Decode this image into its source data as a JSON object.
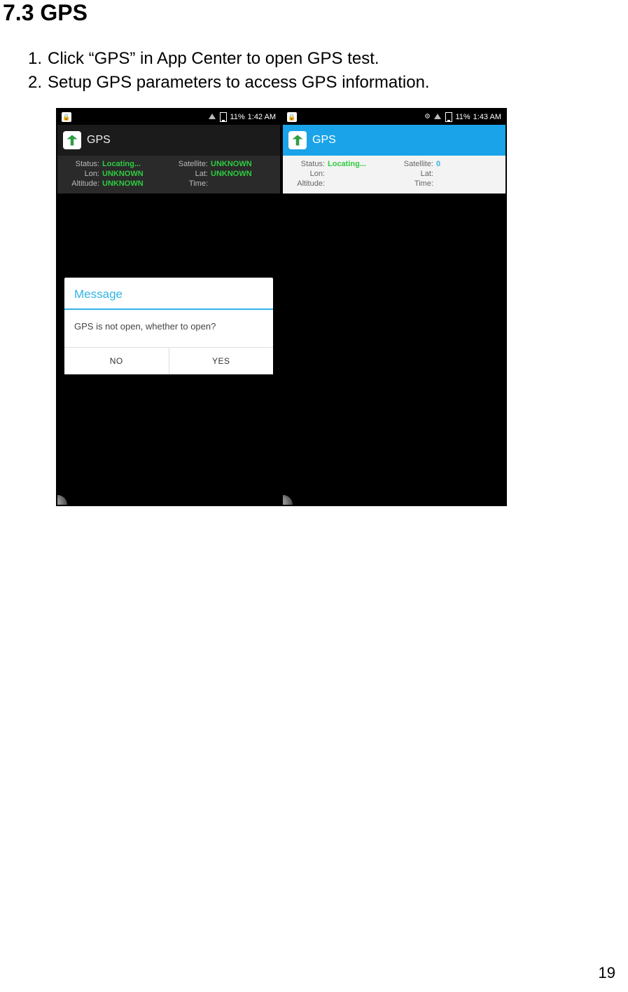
{
  "heading": "7.3 GPS",
  "instructions": [
    "Click “GPS” in App Center to open GPS test.",
    "Setup GPS parameters to access GPS information."
  ],
  "page_number": "19",
  "screen_left": {
    "statusbar": {
      "battery": "11%",
      "time": "1:42 AM",
      "has_location_icon": false
    },
    "appbar": {
      "title": "GPS",
      "style": "dark"
    },
    "info": {
      "status_label": "Status:",
      "status_value": "Locating...",
      "satellite_label": "Satellite:",
      "satellite_value": "UNKNOWN",
      "lon_label": "Lon:",
      "lon_value": "UNKNOWN",
      "lat_label": "Lat:",
      "lat_value": "UNKNOWN",
      "altitude_label": "Altitude:",
      "altitude_value": "UNKNOWN",
      "time_label": "Time:",
      "time_value": ""
    },
    "dialog": {
      "title": "Message",
      "body": "GPS is not open, whether to open?",
      "no_label": "NO",
      "yes_label": "YES"
    }
  },
  "screen_right": {
    "statusbar": {
      "battery": "11%",
      "time": "1:43 AM",
      "has_location_icon": true
    },
    "appbar": {
      "title": "GPS",
      "style": "blue"
    },
    "info": {
      "status_label": "Status:",
      "status_value": "Locating...",
      "satellite_label": "Satellite:",
      "satellite_value": "0",
      "lon_label": "Lon:",
      "lon_value": "",
      "lat_label": "Lat:",
      "lat_value": "",
      "altitude_label": "Altitude:",
      "altitude_value": "",
      "time_label": "Time:",
      "time_value": ""
    }
  }
}
